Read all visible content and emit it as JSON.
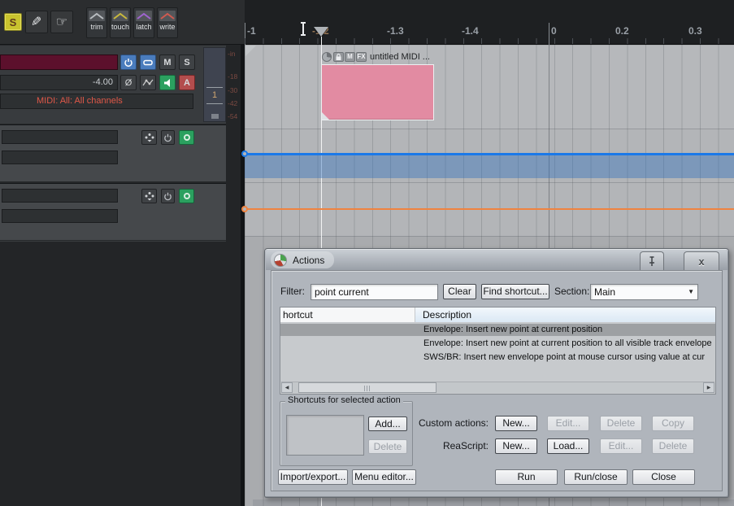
{
  "app": {
    "toolbar": {
      "s_button": "S",
      "automation_modes": [
        {
          "label": "trim",
          "color": "#b8bcc0"
        },
        {
          "label": "touch",
          "color": "#c9b93c"
        },
        {
          "label": "latch",
          "color": "#a064cf"
        },
        {
          "label": "write",
          "color": "#cf5a50"
        }
      ]
    },
    "track": {
      "volume": "-4.00",
      "phase_label": "Ø",
      "mute_label": "M",
      "solo_label": "S",
      "arm_label": "A",
      "routing_text": "MIDI: All: All channels",
      "track_number": "1",
      "meter_scale": [
        "-in",
        "-18",
        "-30",
        "-42",
        "-54"
      ]
    },
    "ruler": {
      "marks": [
        {
          "label": "-1"
        },
        {
          "label": "-1.2"
        },
        {
          "label": "-1.3"
        },
        {
          "label": "-1.4"
        },
        {
          "label": "0"
        },
        {
          "label": "0.2"
        },
        {
          "label": "0.3"
        }
      ]
    },
    "media_item": {
      "name": "untitled MIDI ...",
      "badges": {
        "mute": "M",
        "fx": "FX"
      },
      "color": "#e28ba2"
    },
    "envelopes": {
      "volume_color": "#1b79e8",
      "pan_color": "#ef8340"
    }
  },
  "dialog": {
    "title": "Actions",
    "titlebar": {
      "close_label": "x"
    },
    "filter": {
      "label": "Filter:",
      "value": "point current"
    },
    "clear_button": "Clear",
    "find_shortcut_button": "Find shortcut...",
    "section": {
      "label": "Section:",
      "value": "Main"
    },
    "list": {
      "shortcut_column": "hortcut",
      "description_column": "Description",
      "rows": [
        {
          "description": "Envelope: Insert new point at current position"
        },
        {
          "description": "Envelope: Insert new point at current position to all visible track envelope"
        },
        {
          "description": "SWS/BR: Insert new envelope point at mouse cursor using value at cur"
        }
      ]
    },
    "shortcuts_group": {
      "label": "Shortcuts for selected action",
      "add_button": "Add...",
      "delete_button": "Delete"
    },
    "custom_actions": {
      "label": "Custom actions:",
      "new_button": "New...",
      "edit_button": "Edit...",
      "delete_button": "Delete",
      "copy_button": "Copy"
    },
    "reascript": {
      "label": "ReaScript:",
      "new_button": "New...",
      "load_button": "Load...",
      "edit_button": "Edit...",
      "delete_button": "Delete"
    },
    "footer": {
      "import_export_button": "Import/export...",
      "menu_editor_button": "Menu editor...",
      "run_button": "Run",
      "run_close_button": "Run/close",
      "close_button": "Close"
    }
  }
}
